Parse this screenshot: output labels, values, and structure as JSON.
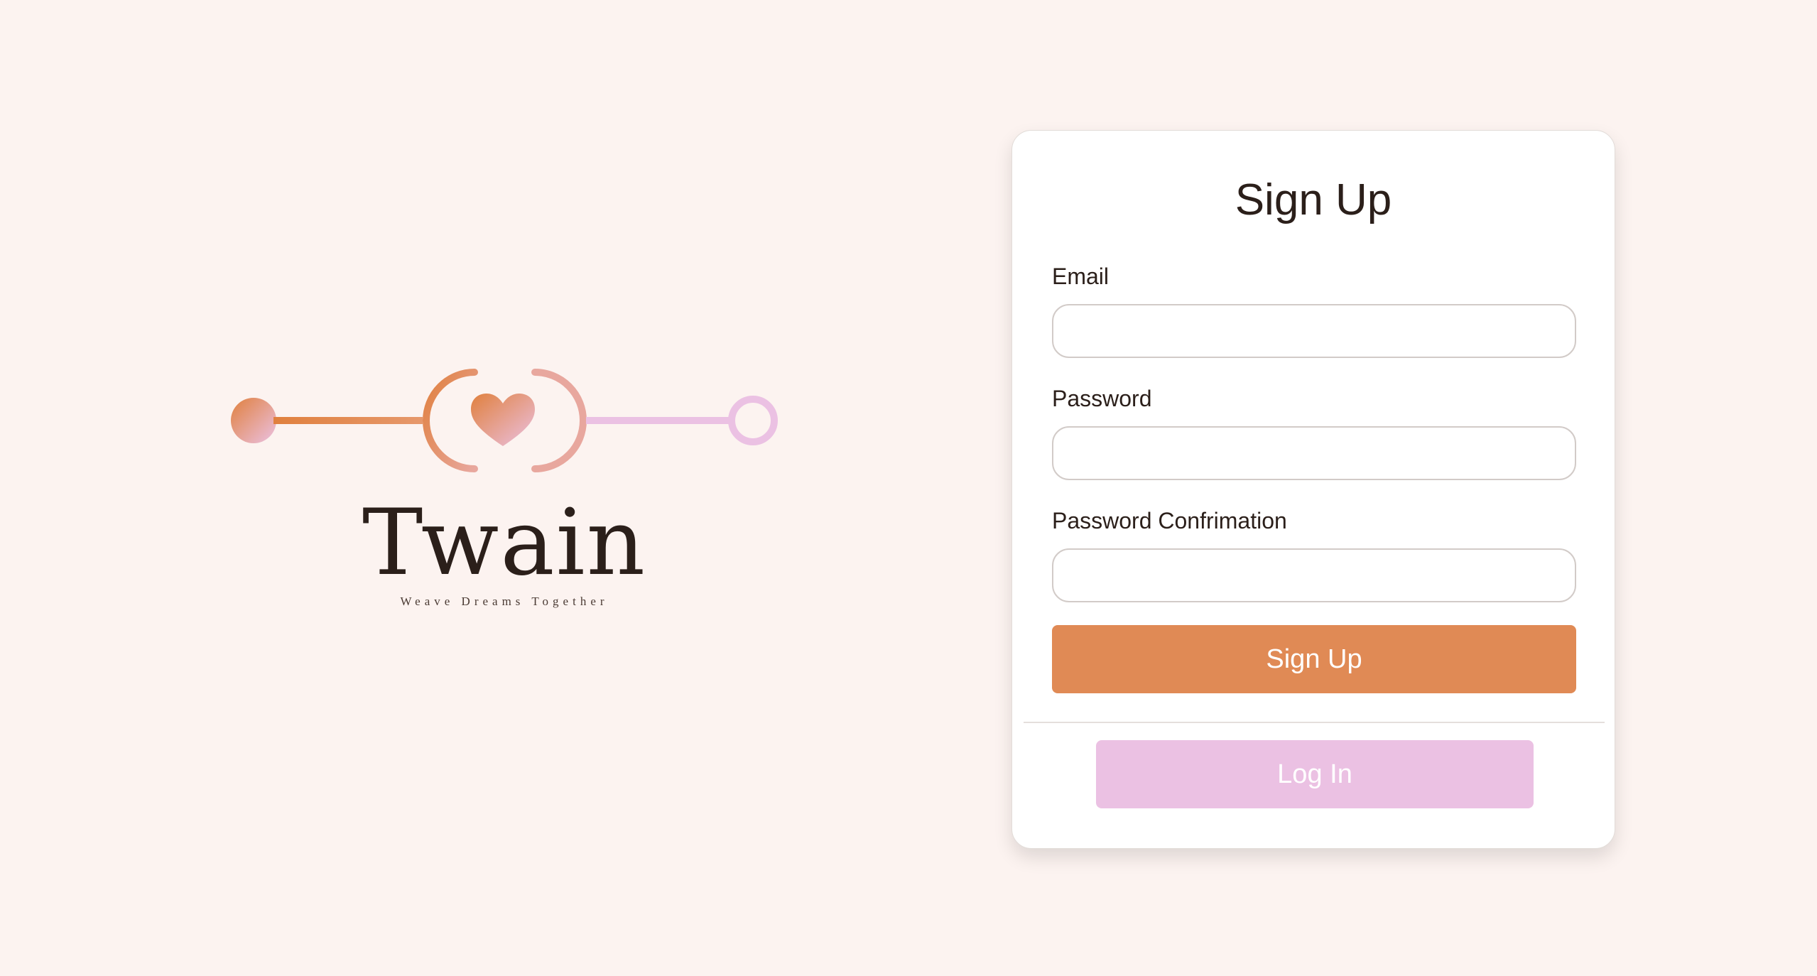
{
  "brand": {
    "name": "Twain",
    "tagline": "Weave Dreams Together",
    "colors": {
      "orange": "#e0803e",
      "salmon": "#e8a79e",
      "pink": "#ebc1e3",
      "dark": "#2b1f1a"
    }
  },
  "signup_form": {
    "title": "Sign Up",
    "fields": [
      {
        "label": "Email",
        "value": "",
        "placeholder": ""
      },
      {
        "label": "Password",
        "value": "",
        "placeholder": ""
      },
      {
        "label": "Password Confrimation",
        "value": "",
        "placeholder": ""
      }
    ],
    "submit_label": "Sign Up",
    "login_label": "Log In"
  },
  "colors": {
    "background": "#fcf3f0",
    "card": "#ffffff",
    "primary_button": "#e08a55",
    "secondary_button": "#ebc1e3"
  }
}
